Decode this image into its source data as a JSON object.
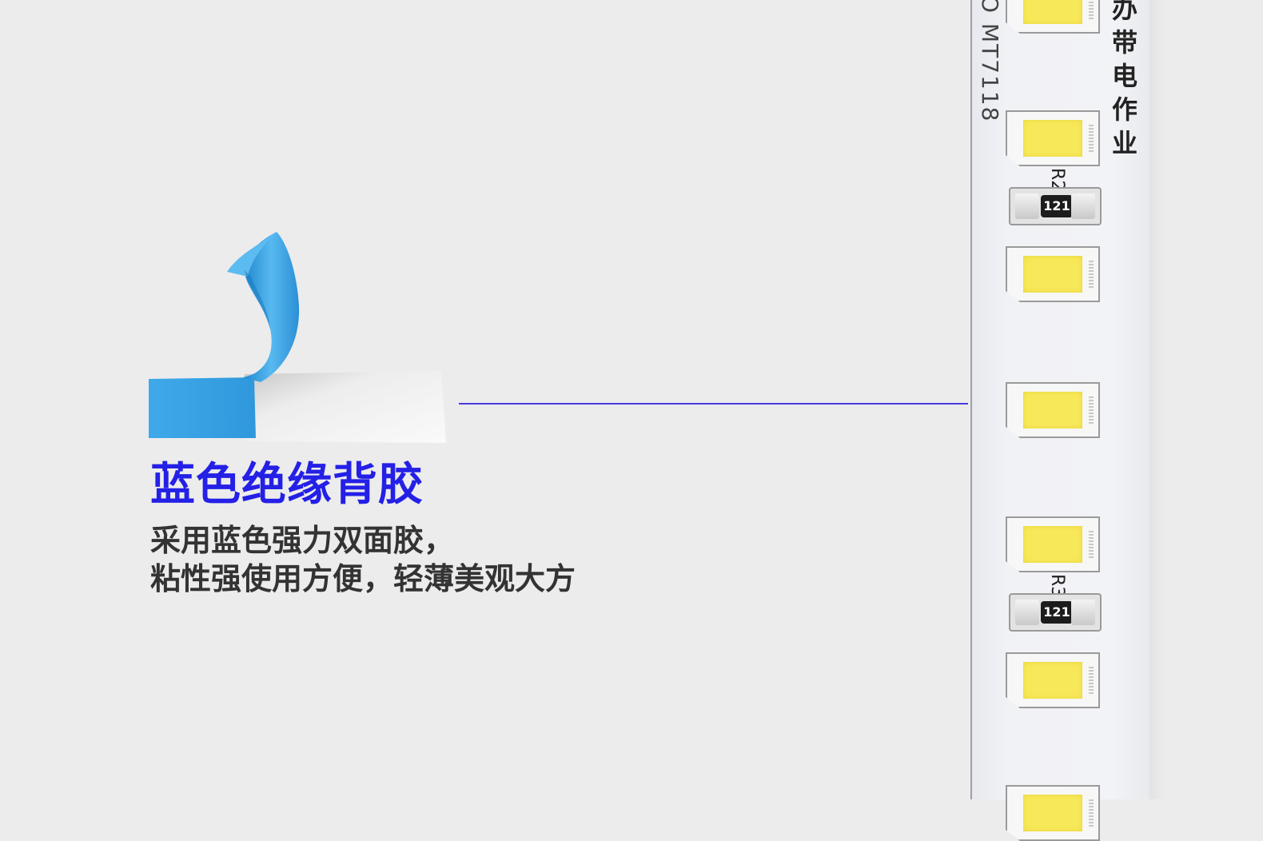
{
  "feature": {
    "title": "蓝色绝缘背胶",
    "description_line1": "采用蓝色强力双面胶，",
    "description_line2": "粘性强使用方便，轻薄美观大方"
  },
  "strip": {
    "chip_model": "O MT7118",
    "vertical_print": "办带电作业",
    "resistors": [
      {
        "ref": "R2",
        "code": "121"
      },
      {
        "ref": "R3",
        "code": "121"
      }
    ]
  },
  "colors": {
    "title": "#2420e6",
    "description": "#333333",
    "callout_line": "#4a3be0",
    "tape_blue": "#3aa7e6",
    "led_emitter": "#f7e85a"
  }
}
